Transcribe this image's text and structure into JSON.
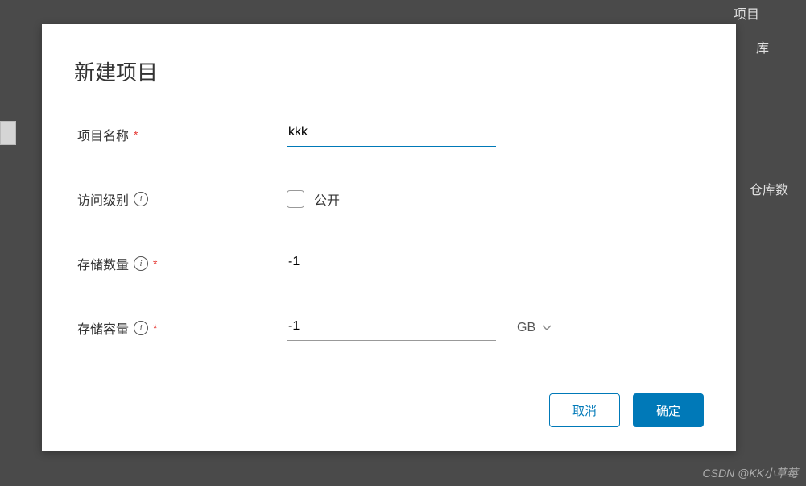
{
  "background": {
    "text1": "项目",
    "text2": "库",
    "text3": "仓库数"
  },
  "modal": {
    "title": "新建项目",
    "fields": {
      "project_name": {
        "label": "项目名称",
        "value": "kkk"
      },
      "access_level": {
        "label": "访问级别",
        "checkbox_label": "公开"
      },
      "storage_count": {
        "label": "存储数量",
        "value": "-1"
      },
      "storage_capacity": {
        "label": "存储容量",
        "value": "-1",
        "unit": "GB"
      }
    },
    "buttons": {
      "cancel": "取消",
      "confirm": "确定"
    }
  },
  "watermark": "CSDN @KK小草莓"
}
